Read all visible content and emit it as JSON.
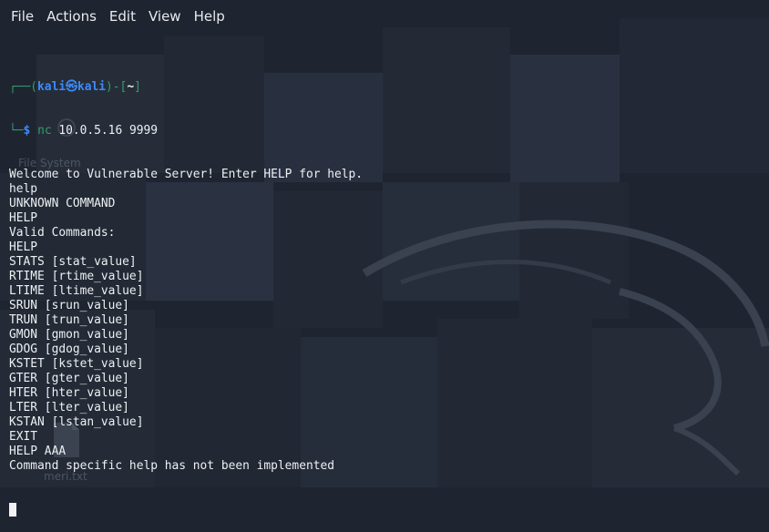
{
  "menu": {
    "items": [
      "File",
      "Actions",
      "Edit",
      "View",
      "Help"
    ]
  },
  "prompt": {
    "user": "kali",
    "at": "㉿",
    "host": "kali",
    "dir": "~",
    "symbol": "$",
    "command": "nc",
    "args": " 10.0.5.16 9999"
  },
  "output": [
    "Welcome to Vulnerable Server! Enter HELP for help.",
    "help",
    "UNKNOWN COMMAND",
    "HELP",
    "Valid Commands:",
    "HELP",
    "STATS [stat_value]",
    "RTIME [rtime_value]",
    "LTIME [ltime_value]",
    "SRUN [srun_value]",
    "TRUN [trun_value]",
    "GMON [gmon_value]",
    "GDOG [gdog_value]",
    "KSTET [kstet_value]",
    "GTER [gter_value]",
    "HTER [hter_value]",
    "LTER [lter_value]",
    "KSTAN [lstan_value]",
    "EXIT",
    "HELP AAA",
    "Command specific help has not been implemented"
  ],
  "desktop": {
    "icon_labels": [
      "File System",
      "meri.txt"
    ]
  },
  "colors": {
    "background": "#1f2530",
    "prompt_blue": "#3d8af7",
    "prompt_green": "#2f9e6b",
    "text": "#eef0f2"
  }
}
